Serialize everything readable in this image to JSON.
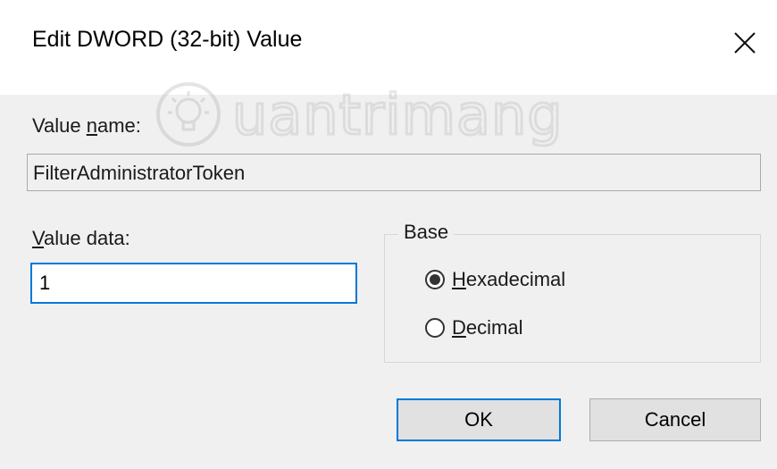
{
  "dialog": {
    "title": "Edit DWORD (32-bit) Value",
    "watermark": "uantrimang"
  },
  "value_name": {
    "label_pre": "Value ",
    "label_accel": "n",
    "label_post": "ame:",
    "value": "FilterAdministratorToken"
  },
  "value_data": {
    "label_accel": "V",
    "label_post": "alue data:",
    "value": "1"
  },
  "base": {
    "legend": "Base",
    "options": [
      {
        "accel": "H",
        "rest": "exadecimal",
        "selected": true
      },
      {
        "accel": "D",
        "rest": "ecimal",
        "selected": false
      }
    ]
  },
  "buttons": {
    "ok": "OK",
    "cancel": "Cancel"
  },
  "colors": {
    "focus_border": "#0078d7",
    "dialog_bg": "#f0f0f0",
    "title_bg": "#ffffff"
  }
}
